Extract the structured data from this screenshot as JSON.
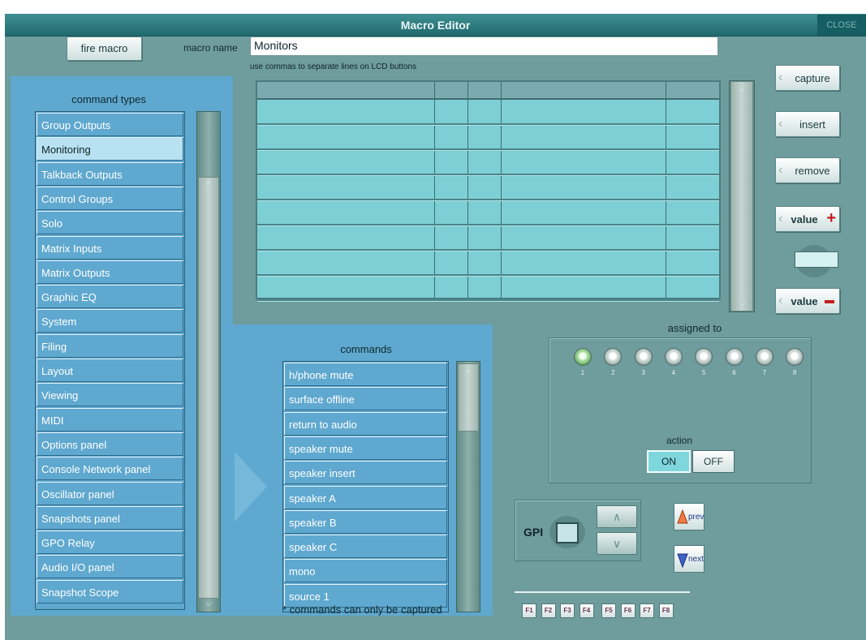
{
  "window": {
    "title": "Macro Editor",
    "close_label": "CLOSE"
  },
  "toolbar": {
    "fire_macro_label": "fire macro",
    "macro_name_label": "macro name",
    "macro_name_value": "Monitors",
    "hint": "use commas to separate lines on LCD buttons"
  },
  "side_buttons": {
    "capture": "capture",
    "insert": "insert",
    "remove": "remove",
    "value_plus": "value",
    "value_minus": "value"
  },
  "command_types": {
    "title": "command types",
    "selected_index": 1,
    "items": [
      "Group Outputs",
      "Monitoring",
      "Talkback Outputs",
      "Control Groups",
      "Solo",
      "Matrix Inputs",
      "Matrix Outputs",
      "Graphic EQ",
      "System",
      "Filing",
      "Layout",
      "Viewing",
      "MIDI",
      "Options panel",
      "Console Network panel",
      "Oscillator panel",
      "Snapshots panel",
      "GPO Relay",
      "Audio I/O panel",
      "Snapshot Scope"
    ]
  },
  "commands": {
    "title": "commands",
    "items": [
      "h/phone mute",
      "surface offline",
      "return to audio",
      "speaker mute",
      "speaker insert",
      "speaker A",
      "speaker B",
      "speaker C",
      "mono",
      "source 1"
    ],
    "footnote": "* commands can only be captured"
  },
  "assigned": {
    "title": "assigned to",
    "leds": [
      "1",
      "2",
      "3",
      "4",
      "5",
      "6",
      "7",
      "8"
    ],
    "active_led": 0,
    "action_label": "action",
    "on_label": "ON",
    "off_label": "OFF",
    "action_state": "ON"
  },
  "gpi": {
    "label": "GPI",
    "prev_label": "prev",
    "next_label": "next"
  },
  "fkeys": [
    "F1",
    "F2",
    "F3",
    "F4",
    "F5",
    "F6",
    "F7",
    "F8"
  ],
  "colors": {
    "accent": "#5fa8cf",
    "selected": "#b8e2f2",
    "panel": "#6f9c9d",
    "title": "#206a6e"
  }
}
